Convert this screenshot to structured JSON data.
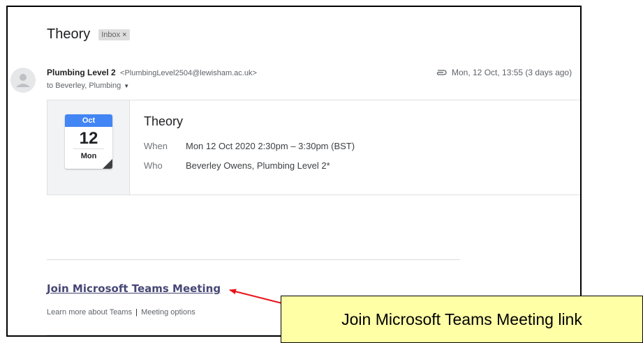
{
  "email": {
    "subject": "Theory",
    "label": "Inbox",
    "label_close": "×",
    "sender_name": "Plumbing Level 2",
    "sender_email": "<PlumbingLevel2504@lewisham.ac.uk>",
    "recipients": "to Beverley, Plumbing",
    "recipients_caret": "▼",
    "date": "Mon, 12 Oct, 13:55 (3 days ago)"
  },
  "invite": {
    "calendar": {
      "month": "Oct",
      "day": "12",
      "weekday": "Mon",
      "month_color": "#4285f4"
    },
    "title": "Theory",
    "when_label": "When",
    "when_value": "Mon 12 Oct 2020 2:30pm – 3:30pm (BST)",
    "who_label": "Who",
    "who_value": "Beverley Owens, Plumbing Level 2*"
  },
  "teams": {
    "join_link": "Join Microsoft Teams Meeting",
    "learn_more": "Learn more about Teams",
    "separator": "|",
    "meeting_options": "Meeting options",
    "link_color": "#464775"
  },
  "annotation": {
    "callout_text": "Join Microsoft Teams Meeting link",
    "arrow_color": "#e8141b",
    "callout_bg": "#ffffa6"
  },
  "icons": {
    "avatar": "person-icon",
    "attachment": "paperclip-icon"
  }
}
